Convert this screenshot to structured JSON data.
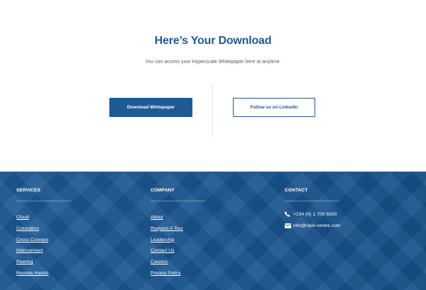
{
  "hero": {
    "title": "Here’s Your Download",
    "subtitle": "You can access your Hyperscale Whitepaper here at anytime.",
    "primary_button": "Download Whitepaper",
    "secondary_button": "Follow us on LinkedIn"
  },
  "footer": {
    "services": {
      "heading": "SERVICES",
      "items": [
        "Cloud",
        "Colocation",
        "Cross Connect",
        "Interconnect",
        "Peering",
        "Remote Hands"
      ]
    },
    "company": {
      "heading": "COMPANY",
      "items": [
        "About",
        "Request A Tour",
        "Leadership",
        "Contact Us",
        "Careers",
        "Privacy Policy"
      ]
    },
    "contact": {
      "heading": "CONTACT",
      "phone": "+234 (0) 1 700 5500",
      "email": "info@rack-centre.com",
      "phone_icon": "phone-icon",
      "email_icon": "envelope-icon"
    }
  },
  "colors": {
    "brand": "#1e5a96",
    "footer_bg": "#1b5792",
    "text_muted": "#5a5a5a"
  }
}
